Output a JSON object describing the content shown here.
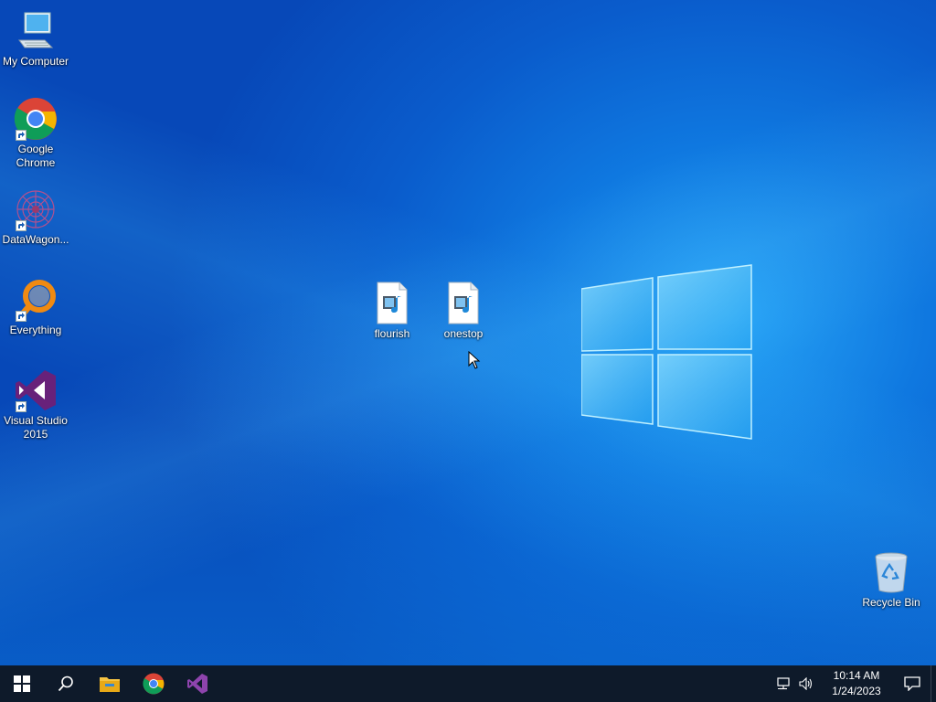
{
  "desktop": {
    "icons": [
      {
        "id": "my-computer",
        "label": "My Computer",
        "icon": "computer-icon"
      },
      {
        "id": "google-chrome",
        "label": "Google\nChrome",
        "icon": "chrome-icon"
      },
      {
        "id": "datawagon",
        "label": "DataWagon...",
        "icon": "datawagon-icon"
      },
      {
        "id": "everything",
        "label": "Everything",
        "icon": "everything-icon"
      },
      {
        "id": "visual-studio",
        "label": "Visual Studio\n2015",
        "icon": "visual-studio-icon"
      },
      {
        "id": "flourish",
        "label": "flourish",
        "icon": "media-file-icon"
      },
      {
        "id": "onestop",
        "label": "onestop",
        "icon": "media-file-icon"
      },
      {
        "id": "recycle-bin",
        "label": "Recycle Bin",
        "icon": "recycle-bin-icon"
      }
    ]
  },
  "taskbar": {
    "buttons": [
      {
        "name": "start-button",
        "icon": "windows-icon"
      },
      {
        "name": "search-button",
        "icon": "search-icon"
      },
      {
        "name": "file-explorer-button",
        "icon": "folder-icon"
      },
      {
        "name": "chrome-taskbar-button",
        "icon": "chrome-icon"
      },
      {
        "name": "visual-studio-taskbar-button",
        "icon": "visual-studio-icon"
      }
    ],
    "tray": {
      "time": "10:14 AM",
      "date": "1/24/2023",
      "icons": [
        "network-icon",
        "volume-icon",
        "notification-icon"
      ]
    }
  },
  "colors": {
    "taskbar": "#0e1a2a",
    "desktop_accent": "#0f78e0"
  }
}
